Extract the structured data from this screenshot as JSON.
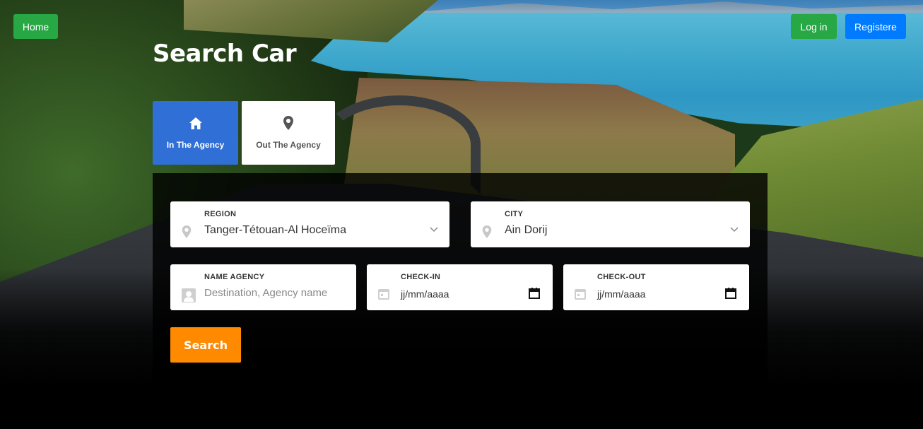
{
  "nav": {
    "home_label": "Home",
    "login_label": "Log in",
    "register_label": "Registere"
  },
  "page": {
    "title": "Search Car"
  },
  "tabs": [
    {
      "label": "In The Agency",
      "icon": "home-icon",
      "active": true
    },
    {
      "label": "Out The Agency",
      "icon": "map-pin-icon",
      "active": false
    }
  ],
  "form": {
    "region": {
      "label": "REGION",
      "value": "Tanger-Tétouan-Al Hoceïma",
      "icon": "map-pin-icon"
    },
    "city": {
      "label": "CITY",
      "value": "Ain Dorij",
      "icon": "map-pin-icon"
    },
    "agency": {
      "label": "NAME AGENCY",
      "placeholder": "Destination, Agency name",
      "icon": "person-card-icon"
    },
    "checkin": {
      "label": "CHECK-IN",
      "value": "jj/mm/aaaa",
      "icon": "calendar-icon"
    },
    "checkout": {
      "label": "CHECK-OUT",
      "value": "jj/mm/aaaa",
      "icon": "calendar-icon"
    },
    "search_label": "Search"
  },
  "colors": {
    "home_green": "#28a745",
    "register_blue": "#007bff",
    "active_tab": "#2f6fd6",
    "search_orange": "#ff8a00"
  }
}
